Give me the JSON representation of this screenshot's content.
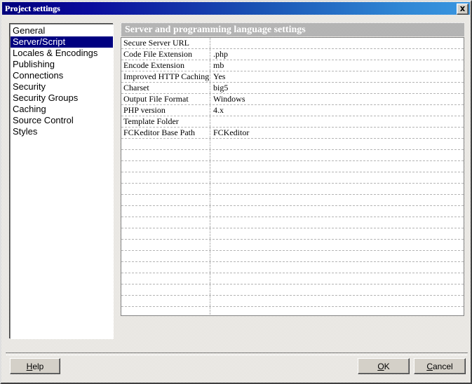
{
  "window": {
    "title": "Project settings",
    "close_icon": "close-x-icon"
  },
  "sidebar": {
    "items": [
      {
        "label": "General",
        "selected": false
      },
      {
        "label": "Server/Script",
        "selected": true
      },
      {
        "label": "Locales & Encodings",
        "selected": false
      },
      {
        "label": "Publishing",
        "selected": false
      },
      {
        "label": "Connections",
        "selected": false
      },
      {
        "label": "Security",
        "selected": false
      },
      {
        "label": "Security Groups",
        "selected": false
      },
      {
        "label": "Caching",
        "selected": false
      },
      {
        "label": "Source Control",
        "selected": false
      },
      {
        "label": "Styles",
        "selected": false
      }
    ],
    "selected_color": "#000080"
  },
  "panel": {
    "header": "Server and programming language settings",
    "rows": [
      {
        "label": "Secure Server URL",
        "value": ""
      },
      {
        "label": "Code File Extension",
        "value": ".php"
      },
      {
        "label": "Encode Extension",
        "value": "mb"
      },
      {
        "label": "Improved HTTP Caching",
        "value": "Yes"
      },
      {
        "label": "Charset",
        "value": "big5"
      },
      {
        "label": "Output File Format",
        "value": "Windows"
      },
      {
        "label": "PHP version",
        "value": "4.x"
      },
      {
        "label": "Template Folder",
        "value": ""
      },
      {
        "label": "FCKeditor Base Path",
        "value": "FCKeditor"
      },
      {
        "label": "",
        "value": ""
      },
      {
        "label": "",
        "value": ""
      },
      {
        "label": "",
        "value": ""
      },
      {
        "label": "",
        "value": ""
      },
      {
        "label": "",
        "value": ""
      },
      {
        "label": "",
        "value": ""
      },
      {
        "label": "",
        "value": ""
      },
      {
        "label": "",
        "value": ""
      },
      {
        "label": "",
        "value": ""
      },
      {
        "label": "",
        "value": ""
      },
      {
        "label": "",
        "value": ""
      },
      {
        "label": "",
        "value": ""
      },
      {
        "label": "",
        "value": ""
      },
      {
        "label": "",
        "value": ""
      },
      {
        "label": "",
        "value": ""
      },
      {
        "label": "",
        "value": ""
      }
    ]
  },
  "footer": {
    "help": {
      "accel": "H",
      "rest": "elp"
    },
    "ok": {
      "accel": "O",
      "rest": "K"
    },
    "cancel": {
      "accel": "C",
      "rest": "ancel"
    }
  }
}
